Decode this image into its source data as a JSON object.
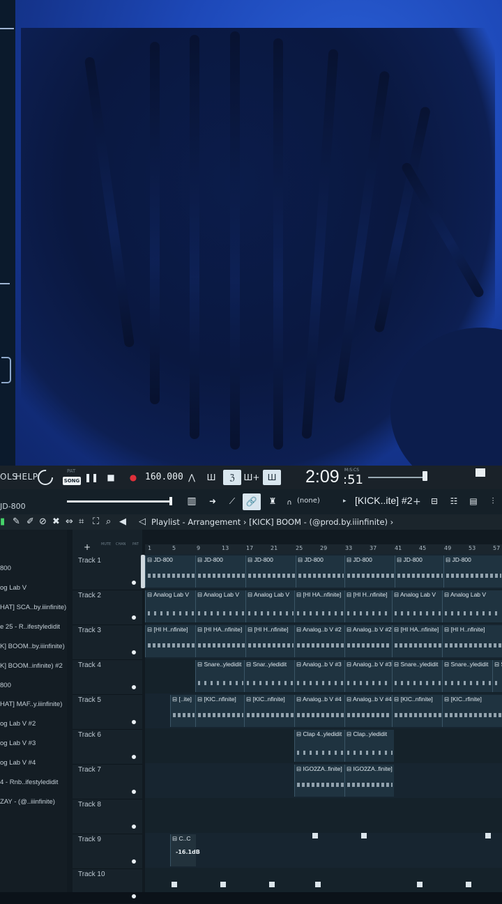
{
  "menu": {
    "tools": "OLS",
    "help": "HELP"
  },
  "transport": {
    "pat_label": "PAT",
    "song_label": "SONG",
    "tempo": "160.000",
    "time_main": "2:09",
    "time_sub": ":51",
    "time_unit": "M:S:CS"
  },
  "row2": {
    "instrument": "JD-800",
    "snap": "(none)",
    "pattern": "[KICK..ite] #2",
    "plus": "+"
  },
  "breadcrumb": {
    "text": "Playlist - Arrangement › [KICK] BOOM - (@prod.by.iiinfinite) ›"
  },
  "browser": {
    "items": [
      "800",
      "og Lab V",
      "HAT] SCA..by.iiinfinite)",
      "e 25 - R..ifestyledidit",
      "K] BOOM..by.iiinfinite)",
      "K] BOOM..infinite) #2",
      "800",
      "HAT] MAF..y.iiinfinite)",
      "og Lab V #2",
      "og Lab V #3",
      "og Lab V #4",
      "4 - Rnb..ifestyledidit",
      "ZAY - (@..iiinfinite)"
    ]
  },
  "header_mini": {
    "mute": "MUTE",
    "chan": "CHAN",
    "pat": "PAT"
  },
  "ruler": [
    "1",
    "5",
    "9",
    "13",
    "17",
    "21",
    "25",
    "29",
    "33",
    "37",
    "41",
    "45",
    "49",
    "53",
    "57"
  ],
  "tracks": [
    {
      "label": "Track 1",
      "clips": [
        "JD-800",
        "JD-800",
        "JD-800",
        "JD-800",
        "JD-800",
        "JD-800",
        "JD-800"
      ]
    },
    {
      "label": "Track 2",
      "clips": [
        "Analog Lab V",
        "Analog Lab V",
        "Analog Lab V",
        "[HI HA..nfinite]",
        "[HI H..nfinite]",
        "Analog Lab V",
        "Analog Lab V"
      ]
    },
    {
      "label": "Track 3",
      "clips": [
        "[HI H..nfinite]",
        "[HI HA..nfinite]",
        "[HI H..nfinite]",
        "Analog..b V #2",
        "Analog..b V #2",
        "[HI HA..nfinite]",
        "[HI H..nfinite]"
      ]
    },
    {
      "label": "Track 4",
      "clips": [
        "Snare..yledidit",
        "Snar..yledidit",
        "Analog..b V #3",
        "Analog..b V #3",
        "Snare..yledidit",
        "Snare..yledidit",
        "S"
      ]
    },
    {
      "label": "Track 5",
      "clips": [
        "[..ite]",
        "[KIC..nfinite]",
        "[KIC..nfinite]",
        "Analog..b V #4",
        "Analog..b V #4",
        "[KIC..nfinite]",
        "[KIC..rfinite]"
      ]
    },
    {
      "label": "Track 6",
      "clips": [
        "Clap 4..yledidit",
        "Clap..yledidit"
      ]
    },
    {
      "label": "Track 7",
      "clips": [
        "IGO2ZA..finite]",
        "IGO2ZA..finite]"
      ]
    },
    {
      "label": "Track 8",
      "clips": []
    },
    {
      "label": "Track 9",
      "clips": [
        "C..C"
      ]
    },
    {
      "label": "Track 10",
      "clips": []
    }
  ],
  "automation": {
    "db": "-16.1dB"
  },
  "icons": [
    "spinner-icon",
    "pause-icon",
    "stop-icon",
    "record-icon",
    "metronome-icon",
    "wait-icon",
    "countdown-icon",
    "step-icon",
    "blend-icon",
    "piano-icon",
    "arrow-right-icon",
    "link-icon",
    "stamp-icon",
    "playlist-icon",
    "mixer-icon"
  ],
  "colors": {
    "record": "#e0303a",
    "accent_light": "#d8e5ee",
    "clip_bg": "#1f3340"
  }
}
